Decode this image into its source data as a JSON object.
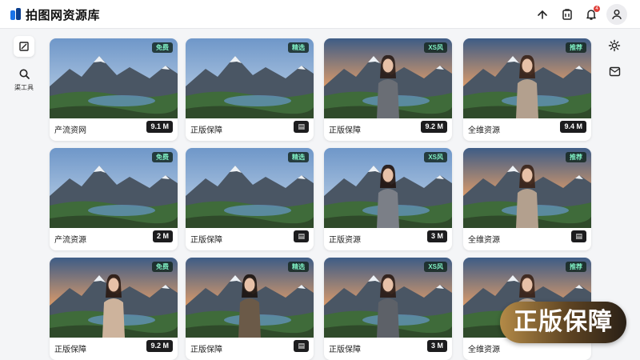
{
  "app": {
    "title": "拍图网资源库",
    "brand_color": "#1a73e8"
  },
  "topbar": {
    "icons": [
      "share-icon",
      "clipboard-icon",
      "bell-icon",
      "user-icon"
    ],
    "notification_count": "4"
  },
  "sidebar_left": {
    "buttons": [
      "crop-icon",
      "search-icon"
    ],
    "search_label": "渠工具"
  },
  "sidebar_right": {
    "buttons": [
      "settings-icon",
      "mail-icon"
    ]
  },
  "cards": [
    {
      "scene": "mountain",
      "tag": "免费",
      "caption": "产流资网",
      "size": "9.1 M"
    },
    {
      "scene": "lake",
      "tag": "精选",
      "caption": "正版保障",
      "size": "▤"
    },
    {
      "scene": "woman-suit",
      "tag": "XS风",
      "caption": "正版保障",
      "size": "9.2 M"
    },
    {
      "scene": "woman-dress",
      "tag": "推荐",
      "caption": "全维资源",
      "size": "9.4 M"
    },
    {
      "scene": "mountain",
      "tag": "免费",
      "caption": "产流资源",
      "size": "2 M"
    },
    {
      "scene": "lake",
      "tag": "精选",
      "caption": "正版保障",
      "size": "▤"
    },
    {
      "scene": "woman-hair",
      "tag": "XS风",
      "caption": "正版资源",
      "size": "3 M"
    },
    {
      "scene": "woman-dress",
      "tag": "推荐",
      "caption": "全维资源",
      "size": "▤"
    },
    {
      "scene": "woman-sweater",
      "tag": "免费",
      "caption": "正版保障",
      "size": "9.2 M"
    },
    {
      "scene": "man-suit",
      "tag": "精选",
      "caption": "正版保障",
      "size": "▤"
    },
    {
      "scene": "woman-coat",
      "tag": "XS风",
      "caption": "正版保障",
      "size": "3 M"
    },
    {
      "scene": "woman-dress",
      "tag": "推荐",
      "caption": "全维资源",
      "size": ""
    }
  ],
  "watermark": {
    "text": "正版保障"
  }
}
